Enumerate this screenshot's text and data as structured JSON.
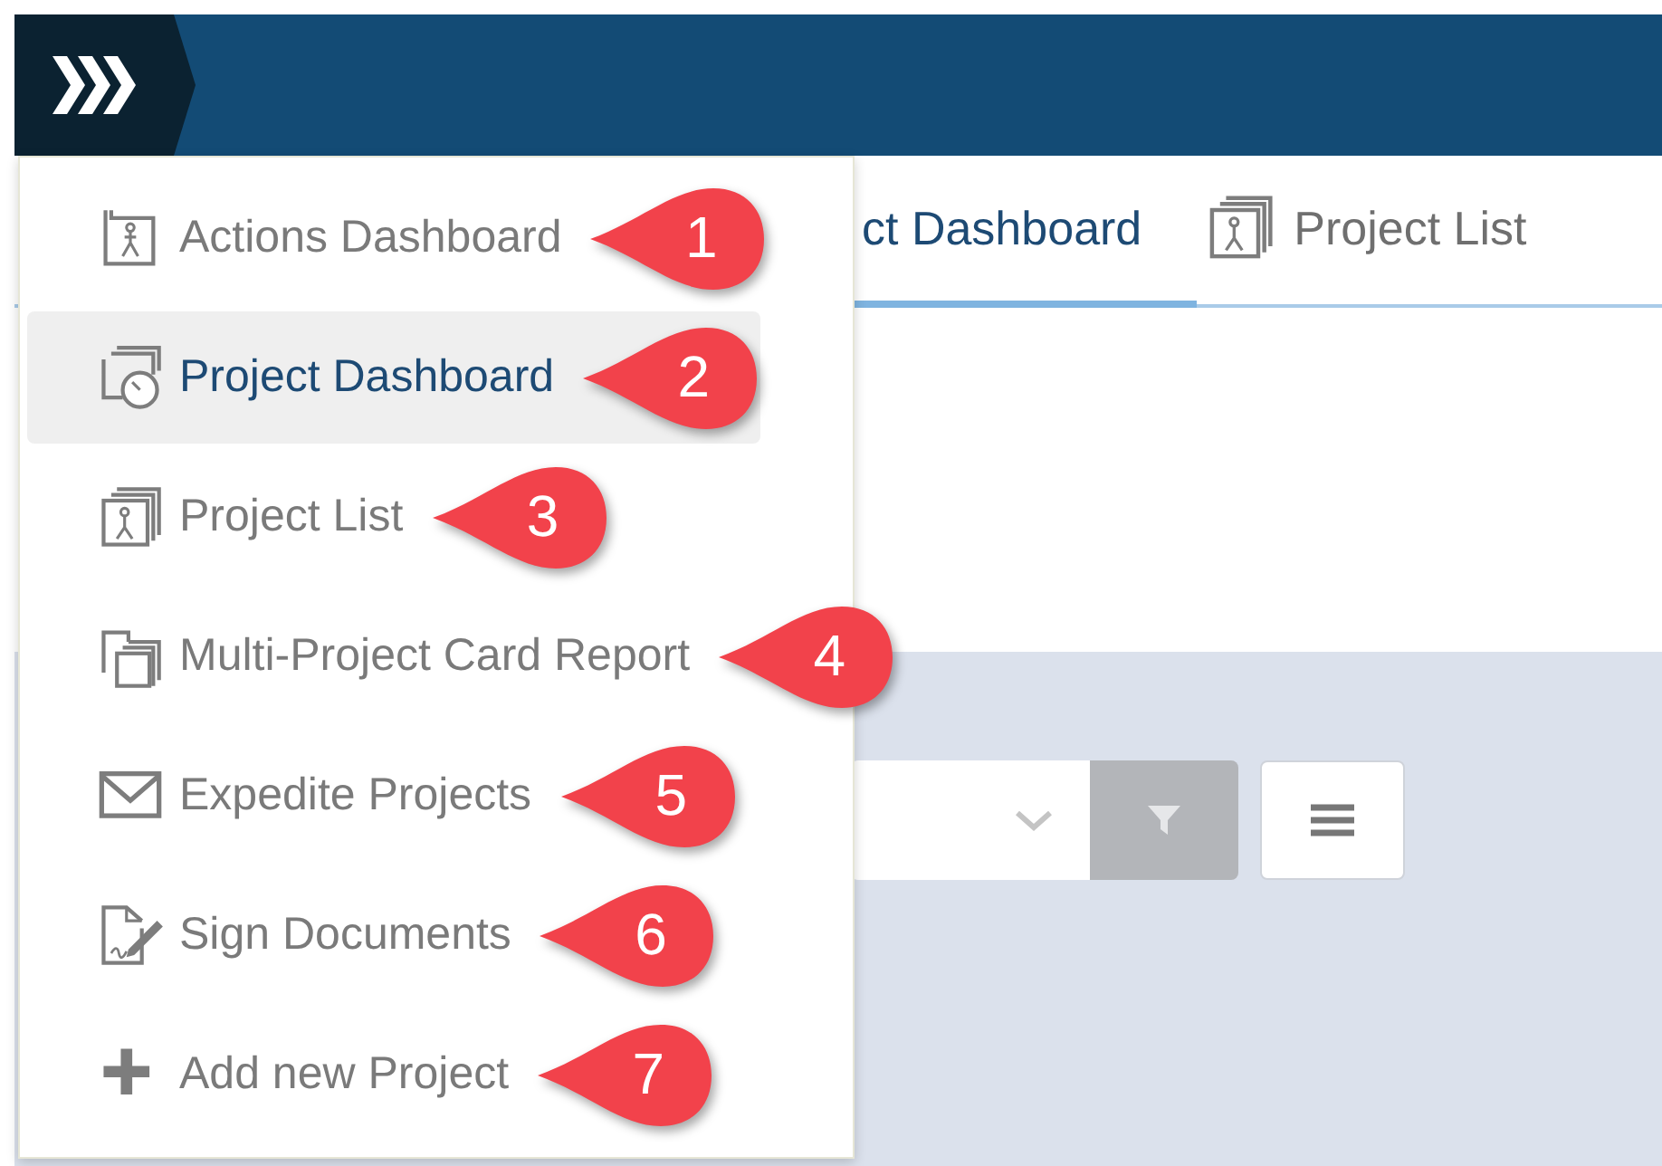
{
  "tabs": [
    {
      "label": "ct Dashboard",
      "selected": true
    },
    {
      "label": "Project List",
      "selected": false
    }
  ],
  "menu": {
    "items": [
      {
        "label": "Actions Dashboard",
        "selected": false,
        "callout": "1"
      },
      {
        "label": "Project Dashboard",
        "selected": true,
        "callout": "2"
      },
      {
        "label": "Project List",
        "selected": false,
        "callout": "3"
      },
      {
        "label": "Multi-Project Card Report",
        "selected": false,
        "callout": "4"
      },
      {
        "label": "Expedite Projects",
        "selected": false,
        "callout": "5"
      },
      {
        "label": "Sign Documents",
        "selected": false,
        "callout": "6"
      },
      {
        "label": "Add new Project",
        "selected": false,
        "callout": "7"
      }
    ]
  }
}
